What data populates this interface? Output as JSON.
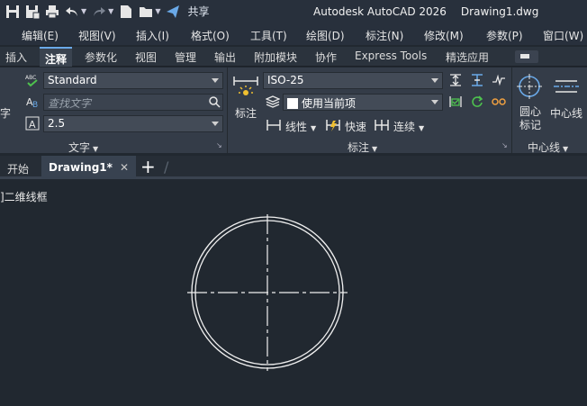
{
  "window": {
    "app_name": "Autodesk AutoCAD 2026",
    "file_name": "Drawing1.dwg"
  },
  "quick_access": {
    "share_label": "共享"
  },
  "menu": [
    "编辑(E)",
    "视图(V)",
    "插入(I)",
    "格式(O)",
    "工具(T)",
    "绘图(D)",
    "标注(N)",
    "修改(M)",
    "参数(P)",
    "窗口(W)"
  ],
  "ribbon_tabs": [
    "插入",
    "注释",
    "参数化",
    "视图",
    "管理",
    "输出",
    "附加模块",
    "协作",
    "Express Tools",
    "精选应用"
  ],
  "active_ribbon_tab": "注释",
  "text_panel": {
    "title": "文字",
    "left_cut_label": "字",
    "text_style": "Standard",
    "find_placeholder": "查找文字",
    "text_height": "2.5"
  },
  "dim_panel": {
    "title": "标注",
    "dimension_button": "标注",
    "dim_style": "ISO-25",
    "layer_value": "使用当前项",
    "linear_label": "线性",
    "quick_label": "快速",
    "continue_label": "连续"
  },
  "centerline_panel": {
    "title": "中心线",
    "center_mark_label_1": "圆心",
    "center_mark_label_2": "标记",
    "centerline_label": "中心线"
  },
  "file_tabs": {
    "start": "开始",
    "drawing": "Drawing1*"
  },
  "viewport": {
    "label": "]二维线框"
  },
  "colors": {
    "accent": "#6aa9e8",
    "canvas_bg": "#212830",
    "ribbon_bg": "#343c48"
  }
}
